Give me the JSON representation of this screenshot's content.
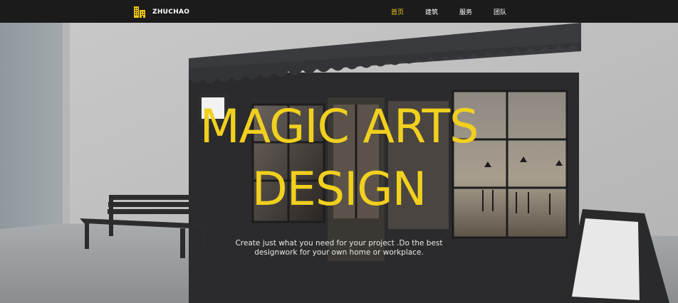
{
  "brand": {
    "logo_icon": "buildings-icon",
    "name": "ZHUCHAO",
    "accent_color": "#f2c818"
  },
  "nav": {
    "items": [
      {
        "label": "首页",
        "active": true
      },
      {
        "label": "建筑",
        "active": false
      },
      {
        "label": "服务",
        "active": false
      },
      {
        "label": "团队",
        "active": false
      }
    ]
  },
  "hero": {
    "title_line1": "MAGIC ARTS",
    "title_line2": "DESIGN",
    "subtitle": "Create just what you need for your project .Do the best designwork for your own home or workplace.",
    "title_color": "#f1d01e"
  }
}
